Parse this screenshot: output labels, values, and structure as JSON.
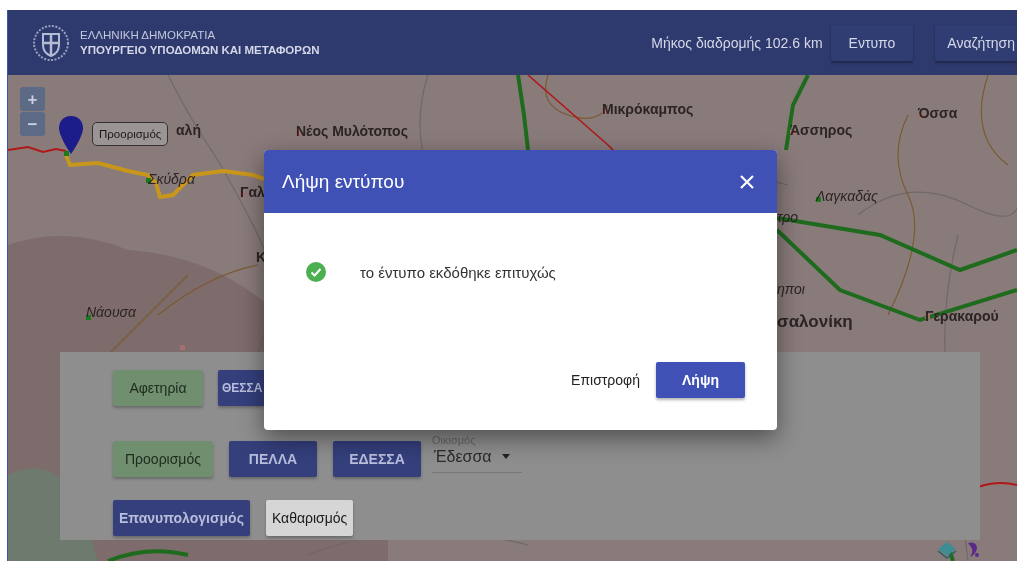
{
  "header": {
    "agency": "ΕΛΛΗΝΙΚΗ ΔΗΜΟΚΡΑΤΙΑ",
    "ministry": "ΥΠΟΥΡΓΕΙΟ ΥΠΟΔΟΜΩΝ ΚΑΙ ΜΕΤΑΦΟΡΩΝ",
    "route_length": "Μήκος διαδρομής 102.6 km",
    "buttons": [
      "Εντυπο",
      "Αναζήτηση"
    ]
  },
  "map": {
    "zoom_buttons": [
      "+",
      "−"
    ],
    "marker_tooltip": "Προορισμός",
    "place_labels": [
      {
        "text": "αλή",
        "kind": "town"
      },
      {
        "text": "Νέος Μυλότοπος",
        "kind": "town"
      },
      {
        "text": "Σκύδρα",
        "kind": "village"
      },
      {
        "text": "Γαλ",
        "kind": "town"
      },
      {
        "text": "Κ",
        "kind": "town"
      },
      {
        "text": "Νάουσα",
        "kind": "village"
      },
      {
        "text": "Μικρόκαμπος",
        "kind": "town"
      },
      {
        "text": "Άσσηρος",
        "kind": "town"
      },
      {
        "text": "Όσσα",
        "kind": "town"
      },
      {
        "text": "Λαγκαδάς",
        "kind": "village"
      },
      {
        "text": "τρο",
        "kind": "village"
      },
      {
        "text": "ηποι",
        "kind": "village"
      },
      {
        "text": "σαλονίκη",
        "kind": "city"
      },
      {
        "text": "Γερακαρού",
        "kind": "town"
      }
    ]
  },
  "route_panel": {
    "rows": [
      {
        "point_button": "Αφετηρία",
        "region_buttons": [
          "ΘΕΣΣΑ"
        ]
      },
      {
        "point_button": "Προορισμός",
        "region_buttons": [
          "ΠΕΛΛΑ",
          "ΕΔΕΣΣΑ"
        ],
        "settlement": {
          "label": "Οικισμός",
          "value": "Έδεσσα"
        }
      }
    ],
    "actions": [
      {
        "label": "Επανυπολογισμός",
        "kind": "primary"
      },
      {
        "label": "Καθαρισμός",
        "kind": "plain"
      }
    ]
  },
  "dialog": {
    "title": "Λήψη εντύπου",
    "message": "το έντυπο εκδόθηκε επιτυχώς",
    "buttons": [
      {
        "label": "Επιστροφή",
        "kind": "text"
      },
      {
        "label": "Λήψη",
        "kind": "primary"
      }
    ]
  }
}
